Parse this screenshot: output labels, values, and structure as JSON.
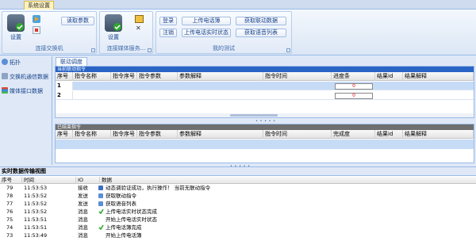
{
  "tabbar": {
    "tab_label": "系统设置"
  },
  "ribbon": {
    "groups": [
      {
        "label": "连接交换机",
        "buttons": {
          "setup": "设置",
          "read_params": "读取参数"
        }
      },
      {
        "label": "连接媒体服务...",
        "buttons": {
          "setup": "设置"
        }
      },
      {
        "label": "我的测试",
        "buttons": {
          "login": "登录",
          "logout": "注销",
          "upload_call": "上传电话簿",
          "upload_call_status": "上传电话实时状态",
          "get_linkage": "获取联动数据",
          "get_voice_list": "获取语音列表"
        }
      }
    ]
  },
  "sidebar": {
    "items": [
      {
        "label": "拓扑",
        "icon": "topology-icon"
      },
      {
        "label": "交换机通信数据",
        "icon": "switch-icon"
      },
      {
        "label": "媒体接口数据",
        "icon": "media-icon"
      }
    ]
  },
  "main": {
    "tab_label": "联动调度",
    "current_panel": {
      "title": "当前联动指令",
      "columns": [
        "序号",
        "指令名称",
        "指令序号",
        "指令参数",
        "参数解释",
        "指令时间",
        "进度条",
        "结果id",
        "结果解释"
      ],
      "rows": [
        {
          "idx": "1",
          "progress": "0"
        },
        {
          "idx": "2",
          "progress": "0"
        }
      ]
    },
    "done_panel": {
      "title": "已结束指令",
      "columns": [
        "序号",
        "指令名称",
        "指令序号",
        "指令参数",
        "参数解释",
        "指令时间",
        "完成度",
        "结果id",
        "结果解释"
      ]
    }
  },
  "log": {
    "title": "实时数据传输视图",
    "columns": [
      "序号",
      "时间",
      "IO",
      "数据"
    ],
    "rows": [
      {
        "seq": "79",
        "time": "11:53:53",
        "io": "接收",
        "icon": "receive-icon",
        "text": "动态调验证成功，执行操作！  当前无联动指令"
      },
      {
        "seq": "78",
        "time": "11:53:52",
        "io": "发送",
        "icon": "send-icon",
        "text": "获取联动指令"
      },
      {
        "seq": "77",
        "time": "11:53:52",
        "io": "发送",
        "icon": "send-icon",
        "text": "获取语音列表"
      },
      {
        "seq": "76",
        "time": "11:53:52",
        "io": "消息",
        "icon": "check-icon",
        "text": "上传电话实时状态完成"
      },
      {
        "seq": "75",
        "time": "11:53:51",
        "io": "消息",
        "icon": "",
        "text": "开始上传电话实时状态"
      },
      {
        "seq": "74",
        "time": "11:53:51",
        "io": "消息",
        "icon": "check-icon",
        "text": "上传电话簿完成"
      },
      {
        "seq": "73",
        "time": "11:53:49",
        "io": "消息",
        "icon": "",
        "text": "开始上传电话簿"
      }
    ]
  },
  "colors": {
    "accent_blue": "#2a64c5",
    "done_header": "#6f6f6f",
    "check_green": "#2fa82f"
  }
}
